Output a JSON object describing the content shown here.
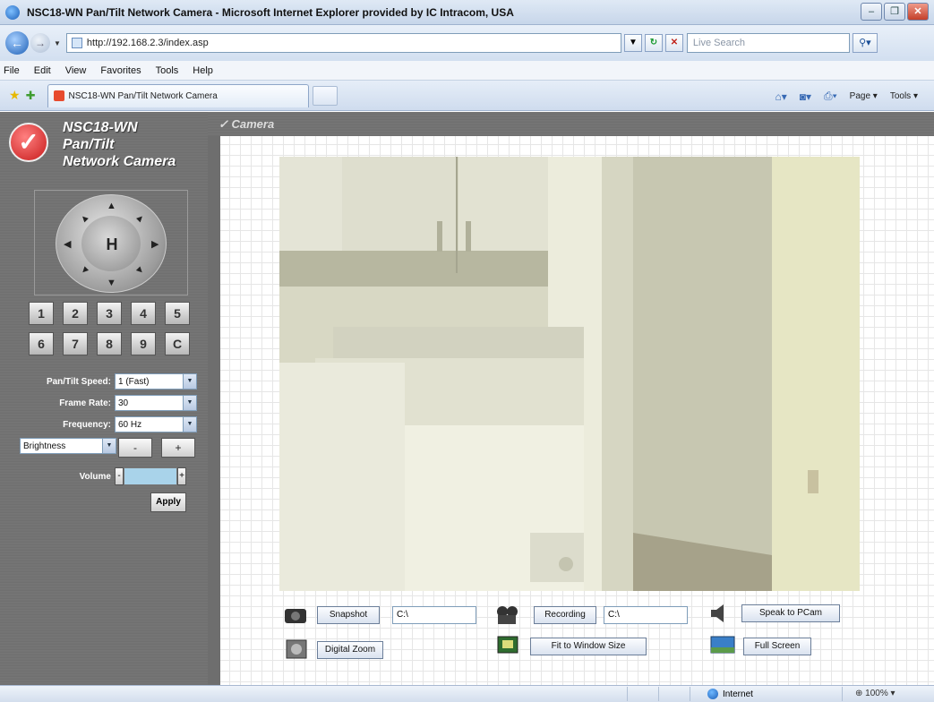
{
  "window": {
    "title": "NSC18-WN Pan/Tilt Network Camera - Microsoft Internet Explorer provided by IC Intracom, USA",
    "minimize": "–",
    "maximize": "❐",
    "close": "✕"
  },
  "address_bar": {
    "url": "http://192.168.2.3/index.asp",
    "search_placeholder": "Live Search"
  },
  "menu": [
    "File",
    "Edit",
    "View",
    "Favorites",
    "Tools",
    "Help"
  ],
  "tab": {
    "label": "NSC18-WN Pan/Tilt Network Camera"
  },
  "command_bar": {
    "page_label": "Page",
    "tools_label": "Tools"
  },
  "brand": {
    "line1": "NSC18-WN",
    "line2": "Pan/Tilt",
    "line3": "Network Camera",
    "badge": "✓"
  },
  "ptz": {
    "home": "H"
  },
  "presets": [
    "1",
    "2",
    "3",
    "4",
    "5",
    "6",
    "7",
    "8",
    "9",
    "C"
  ],
  "controls": {
    "pan_tilt_speed_label": "Pan/Tilt Speed:",
    "pan_tilt_speed_value": "1 (Fast)",
    "frame_rate_label": "Frame Rate:",
    "frame_rate_value": "30",
    "frequency_label": "Frequency:",
    "frequency_value": "60 Hz",
    "image_setting_value": "Brightness",
    "minus": "-",
    "plus": "+",
    "volume_label": "Volume",
    "apply": "Apply"
  },
  "camera_section": {
    "title": "✓ Camera"
  },
  "actions": {
    "snapshot": "Snapshot",
    "snapshot_path": "C:\\",
    "recording": "Recording",
    "recording_path": "C:\\",
    "speak": "Speak to PCam",
    "digital_zoom": "Digital Zoom",
    "fit_window": "Fit to Window Size",
    "full_screen": "Full Screen"
  },
  "status_bar": {
    "zone": "Internet",
    "zoom": "100%"
  },
  "colors": {
    "panel_gray": "#737373",
    "brand_red": "#c71b1b",
    "ie_blue": "#1b5fb8"
  }
}
